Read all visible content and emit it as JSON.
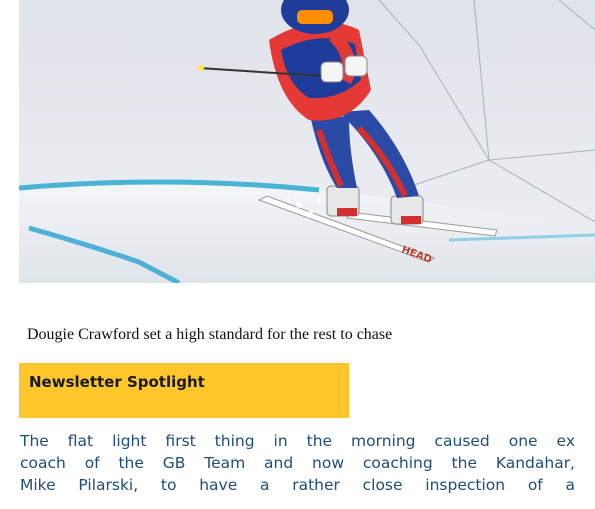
{
  "photo": {
    "ski_brand": "HEAD"
  },
  "caption": "Dougie Crawford set a high standard for the rest to chase",
  "spotlight": {
    "title": "Newsletter Spotlight",
    "color": "#ffc72c"
  },
  "article": {
    "lines": [
      "The flat light first thing in the morning caused one ex",
      "coach of the GB Team and now coaching the Kandahar,",
      "Mike Pilarski, to have a rather close inspection of a"
    ],
    "text_color": "#1f4e79"
  }
}
